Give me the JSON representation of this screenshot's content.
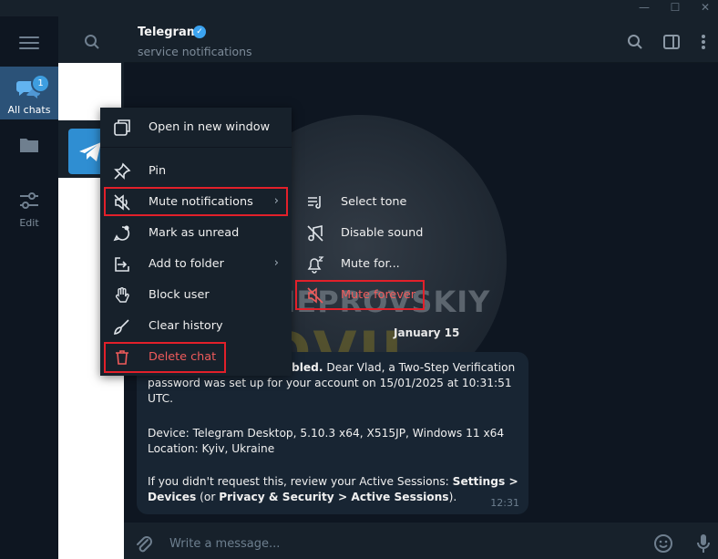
{
  "window": {
    "controls": [
      "minimize",
      "maximize",
      "close"
    ]
  },
  "sidebar": {
    "folders": [
      {
        "label": "All chats",
        "badge": "1",
        "active": true
      },
      {
        "label": "",
        "icon": "folder-icon"
      },
      {
        "label": "Edit",
        "icon": "sliders-icon"
      }
    ]
  },
  "header": {
    "title": "Telegram",
    "subtitle": "service notifications"
  },
  "context_menu": {
    "items": [
      {
        "label": "Open in new window",
        "icon": "new-window-icon"
      },
      {
        "label": "Pin",
        "icon": "pin-icon"
      },
      {
        "label": "Mute notifications",
        "icon": "mute-icon",
        "submenu": true
      },
      {
        "label": "Mark as unread",
        "icon": "unread-icon"
      },
      {
        "label": "Add to folder",
        "icon": "folder-add-icon",
        "submenu": true
      },
      {
        "label": "Block user",
        "icon": "hand-icon"
      },
      {
        "label": "Clear history",
        "icon": "broom-icon"
      },
      {
        "label": "Delete chat",
        "icon": "trash-icon",
        "danger": true
      }
    ]
  },
  "mute_submenu": {
    "items": [
      {
        "label": "Select tone",
        "icon": "tone-icon"
      },
      {
        "label": "Disable sound",
        "icon": "sound-off-icon"
      },
      {
        "label": "Mute for...",
        "icon": "bell-z-icon"
      },
      {
        "label": "Mute forever",
        "icon": "mute-forever-icon",
        "danger": true
      }
    ]
  },
  "watermark": {
    "line1": "DNEPROVSKIY",
    "line2": "DVIJ"
  },
  "messages": {
    "date": "January 15",
    "line1_bold": "bled.",
    "line1": " Dear Vlad, a Two-Step Verification",
    "line2": "password was set up for your account on 15/01/2025 at 10:31:51",
    "line3": "UTC.",
    "device": "Device: Telegram Desktop, 5.10.3 x64, X515JP, Windows 11 x64",
    "location": "Location: Kyiv, Ukraine",
    "line6_pre": "If you didn't request this, review your Active Sessions: ",
    "line6_bold": "Settings >",
    "line7_bold1": "Devices",
    "line7_mid": " (or ",
    "line7_bold2": "Privacy & Security > Active Sessions",
    "line7_end": ").",
    "time": "12:31"
  },
  "composer": {
    "placeholder": "Write a message..."
  },
  "colors": {
    "accent": "#2b5278",
    "danger": "#ef5b5b",
    "highlight_box": "#e2202a"
  }
}
